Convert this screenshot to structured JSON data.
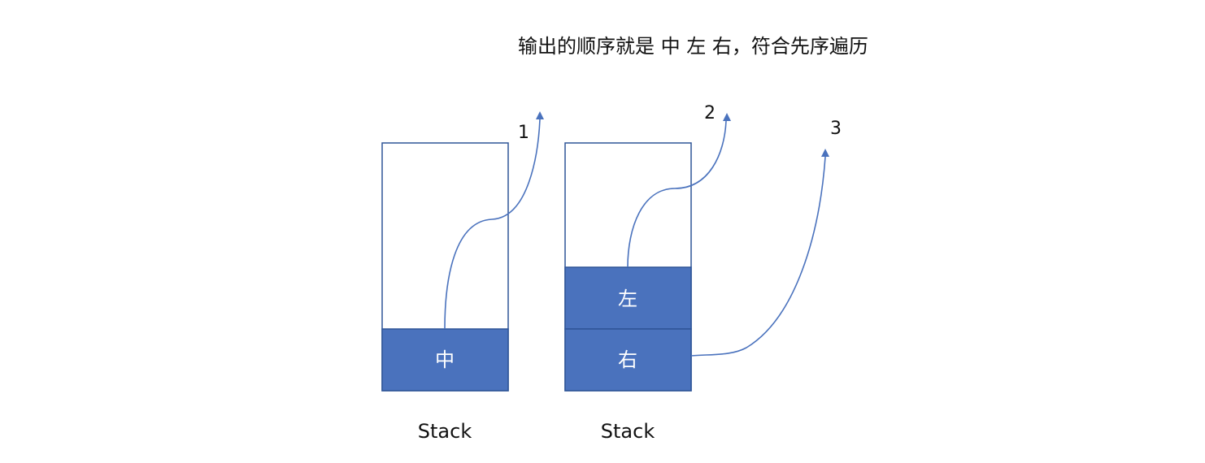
{
  "caption": "输出的顺序就是 中 左 右，符合先序遍历",
  "stacks": [
    {
      "label": "Stack",
      "cells": [
        "中"
      ]
    },
    {
      "label": "Stack",
      "cells": [
        "左",
        "右"
      ]
    }
  ],
  "steps": [
    "1",
    "2",
    "3"
  ],
  "colors": {
    "cell_fill": "#4a72bd",
    "stroke": "#2f5597",
    "cell_text": "#ffffff"
  }
}
